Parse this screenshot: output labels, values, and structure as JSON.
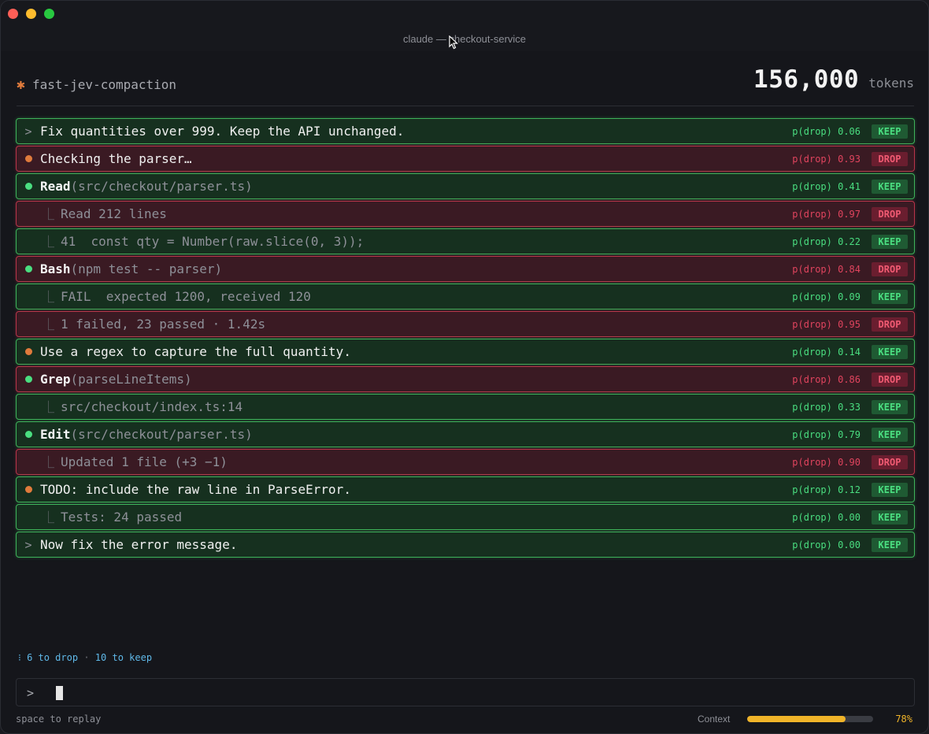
{
  "window": {
    "title": "claude — checkout-service"
  },
  "header": {
    "session_name": "fast-jev-compaction",
    "tokens_count": "156,000",
    "tokens_label": "tokens"
  },
  "rows": [
    {
      "kind": "prompt",
      "status": "keep",
      "text": "Fix quantities over 999. Keep the API unchanged.",
      "pdrop": "p(drop) 0.06",
      "badge": "KEEP"
    },
    {
      "kind": "dot",
      "dot": "orange",
      "status": "drop",
      "text": "Checking the parser…",
      "pdrop": "p(drop) 0.93",
      "badge": "DROP"
    },
    {
      "kind": "tool",
      "dot": "green",
      "status": "keep",
      "tool": "Read",
      "args": "(src/checkout/parser.ts)",
      "pdrop": "p(drop) 0.41",
      "badge": "KEEP"
    },
    {
      "kind": "sub",
      "status": "drop",
      "text": "Read 212 lines",
      "pdrop": "p(drop) 0.97",
      "badge": "DROP"
    },
    {
      "kind": "sub",
      "status": "keep",
      "text": "41  const qty = Number(raw.slice(0, 3));",
      "pdrop": "p(drop) 0.22",
      "badge": "KEEP"
    },
    {
      "kind": "tool",
      "dot": "green",
      "status": "drop",
      "tool": "Bash",
      "args": "(npm test -- parser)",
      "pdrop": "p(drop) 0.84",
      "badge": "DROP"
    },
    {
      "kind": "sub",
      "status": "keep",
      "text": "FAIL  expected 1200, received 120",
      "pdrop": "p(drop) 0.09",
      "badge": "KEEP"
    },
    {
      "kind": "sub",
      "status": "drop",
      "text": "1 failed, 23 passed · 1.42s",
      "pdrop": "p(drop) 0.95",
      "badge": "DROP"
    },
    {
      "kind": "dot",
      "dot": "orange",
      "status": "keep",
      "text": "Use a regex to capture the full quantity.",
      "pdrop": "p(drop) 0.14",
      "badge": "KEEP"
    },
    {
      "kind": "tool",
      "dot": "green",
      "status": "drop",
      "tool": "Grep",
      "args": "(parseLineItems)",
      "pdrop": "p(drop) 0.86",
      "badge": "DROP"
    },
    {
      "kind": "sub",
      "status": "keep",
      "text": "src/checkout/index.ts:14",
      "pdrop": "p(drop) 0.33",
      "badge": "KEEP"
    },
    {
      "kind": "tool",
      "dot": "green",
      "status": "keep",
      "tool": "Edit",
      "args": "(src/checkout/parser.ts)",
      "pdrop": "p(drop) 0.79",
      "badge": "KEEP"
    },
    {
      "kind": "sub",
      "status": "drop",
      "text": "Updated 1 file (+3 −1)",
      "pdrop": "p(drop) 0.90",
      "badge": "DROP"
    },
    {
      "kind": "dot",
      "dot": "orange",
      "status": "keep",
      "text": "TODO: include the raw line in ParseError.",
      "pdrop": "p(drop) 0.12",
      "badge": "KEEP"
    },
    {
      "kind": "sub",
      "status": "keep",
      "text": "Tests: 24 passed",
      "pdrop": "p(drop) 0.00",
      "badge": "KEEP"
    },
    {
      "kind": "prompt",
      "status": "keep",
      "text": "Now fix the error message.",
      "pdrop": "p(drop) 0.00",
      "badge": "KEEP"
    }
  ],
  "symbols": {
    "prompt": ">",
    "sub_branch": "⎿",
    "session_icon": "✱"
  },
  "summary": {
    "icon": "⁝",
    "drop": "6 to drop",
    "sep": "·",
    "keep": "10 to keep"
  },
  "input": {
    "prompt": ">"
  },
  "footer": {
    "hint": "space to replay",
    "context_label": "Context",
    "context_percent": "78%",
    "context_fraction": 0.78
  },
  "colors": {
    "keep": "#3eb25a",
    "drop": "#b8344a",
    "accent": "#e07b3c",
    "context": "#f0b429"
  }
}
